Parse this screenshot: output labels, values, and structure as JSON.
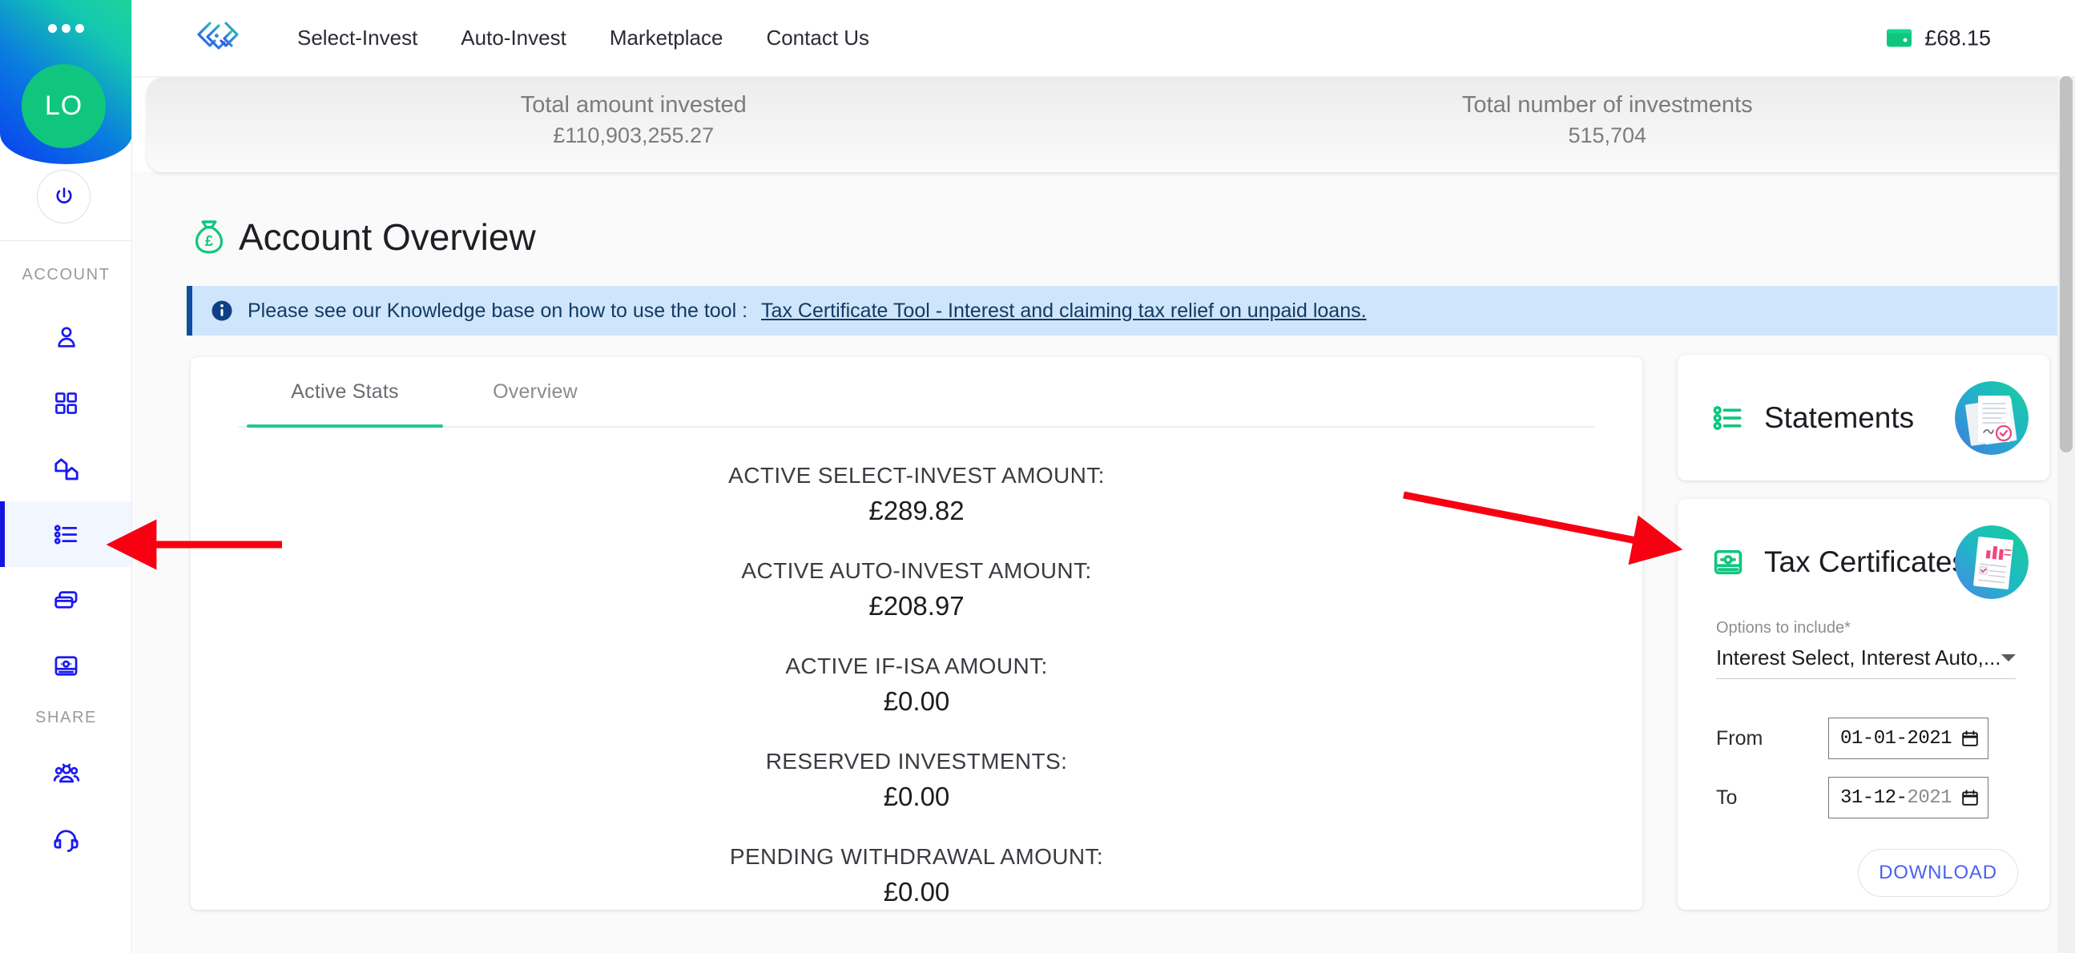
{
  "sidebar": {
    "menu_icon": "more-dots-icon",
    "avatar_initials": "LO",
    "power_icon": "power-icon",
    "sections": [
      {
        "label": "ACCOUNT",
        "items": [
          {
            "name": "profile",
            "icon": "user-icon",
            "active": false
          },
          {
            "name": "dashboard",
            "icon": "grid-icon",
            "active": false
          },
          {
            "name": "properties",
            "icon": "houses-icon",
            "active": false
          },
          {
            "name": "account-overview",
            "icon": "list-icon",
            "active": true
          },
          {
            "name": "cards",
            "icon": "cards-icon",
            "active": false
          },
          {
            "name": "tax-certificates",
            "icon": "id-card-icon",
            "active": false
          }
        ]
      },
      {
        "label": "SHARE",
        "items": [
          {
            "name": "refer-friends",
            "icon": "people-group-icon",
            "active": false
          },
          {
            "name": "support",
            "icon": "headset-icon",
            "active": false
          }
        ]
      }
    ]
  },
  "topnav": {
    "logo": "brand-logo-icon",
    "links": [
      {
        "label": "Select-Invest"
      },
      {
        "label": "Auto-Invest"
      },
      {
        "label": "Marketplace"
      },
      {
        "label": "Contact Us"
      }
    ],
    "wallet": {
      "icon": "wallet-icon",
      "balance": "£68.15"
    }
  },
  "statsbar": {
    "stats": [
      {
        "label": "Total amount invested",
        "value": "£110,903,255.27"
      },
      {
        "label": "Total number of investments",
        "value": "515,704"
      }
    ]
  },
  "page": {
    "icon": "money-bag-icon",
    "title": "Account Overview",
    "info": {
      "icon": "info-icon",
      "text": "Please see our Knowledge base on how to use the tool :",
      "link": "Tax Certificate Tool - Interest and claiming tax relief on unpaid loans."
    }
  },
  "main_card": {
    "tabs": [
      {
        "label": "Active Stats",
        "active": true
      },
      {
        "label": "Overview",
        "active": false
      }
    ],
    "stats": [
      {
        "label": "ACTIVE SELECT-INVEST AMOUNT:",
        "value": "£289.82"
      },
      {
        "label": "ACTIVE AUTO-INVEST AMOUNT:",
        "value": "£208.97"
      },
      {
        "label": "ACTIVE IF-ISA AMOUNT:",
        "value": "£0.00"
      },
      {
        "label": "RESERVED INVESTMENTS:",
        "value": "£0.00"
      },
      {
        "label": "PENDING WITHDRAWAL AMOUNT:",
        "value": "£0.00"
      }
    ]
  },
  "statements_card": {
    "icon": "list-green-icon",
    "title": "Statements",
    "illustration": "documents-certificate-illustration"
  },
  "tax_card": {
    "icon": "id-card-green-icon",
    "title": "Tax Certificates",
    "illustration": "tax-report-illustration",
    "options_label": "Options to include*",
    "options_value": "Interest Select, Interest Auto,...",
    "caret": "chevron-down-icon",
    "from_label": "From",
    "from_value": "01-01-2021",
    "to_label": "To",
    "to_value_month": "31-12-",
    "to_value_year": "2021",
    "calendar_icon": "calendar-icon",
    "download_label": "DOWNLOAD"
  },
  "annotations": {
    "arrow_color": "#f60012",
    "arrows": [
      {
        "name": "arrow-to-sidebar-list-item"
      },
      {
        "name": "arrow-to-tax-certificates-card"
      }
    ]
  },
  "colors": {
    "brand_green": "#10c67e",
    "brand_blue": "#1414e0",
    "accent_blue": "#4a62f0",
    "tab_active": "#1ec98e",
    "info_bg": "#cfe5fb"
  }
}
